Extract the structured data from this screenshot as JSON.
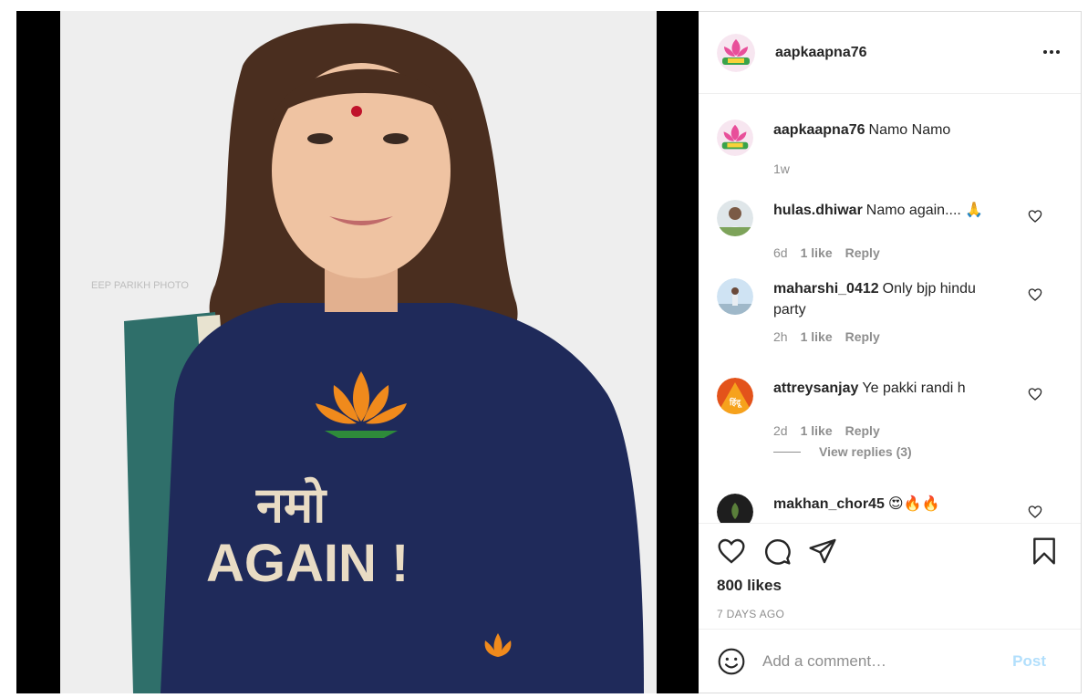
{
  "post": {
    "username": "aapkaapna76",
    "image_watermark": "EEP PARIKH PHOTO",
    "shirt_text": {
      "hindi": "नमो",
      "english": "AGAIN !"
    }
  },
  "caption": {
    "username": "aapkaapna76",
    "text": "Namo Namo",
    "time": "1w"
  },
  "comments": [
    {
      "username": "hulas.dhiwar",
      "text": "Namo again.... 🙏",
      "time": "6d",
      "likes": "1 like",
      "reply": "Reply"
    },
    {
      "username": "maharshi_0412",
      "text": "Only bjp hindu party",
      "time": "2h",
      "likes": "1 like",
      "reply": "Reply"
    },
    {
      "username": "attreysanjay",
      "text": "Ye pakki randi h",
      "time": "2d",
      "likes": "1 like",
      "reply": "Reply",
      "avatar_text": "हिंदू"
    },
    {
      "username": "makhan_chor45",
      "text": "😍🔥🔥"
    }
  ],
  "view_replies": "View replies (3)",
  "likes_count": "800 likes",
  "posted_ago": "7 DAYS AGO",
  "add_comment": {
    "placeholder": "Add a comment…",
    "post_label": "Post"
  },
  "colors": {
    "link_blue_disabled": "#b2dffc",
    "text_primary": "#262626",
    "text_secondary": "#8e8e8e",
    "shirt_navy": "#1f2a5a"
  },
  "icons": [
    "more-options-icon",
    "heart-icon",
    "comment-icon",
    "share-icon",
    "bookmark-icon",
    "emoji-icon"
  ]
}
